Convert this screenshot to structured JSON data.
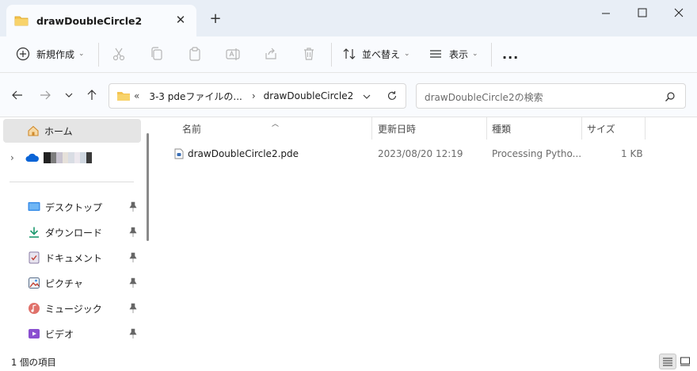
{
  "window": {
    "tab_title": "drawDoubleCircle2",
    "colors": {
      "folder": "#f4c350",
      "accent": "#0067c0",
      "onedrive": "#0a64d6"
    }
  },
  "toolbar": {
    "new_label": "新規作成",
    "sort_label": "並べ替え",
    "view_label": "表示",
    "more_label": "..."
  },
  "address": {
    "overflow": "«",
    "crumbs": [
      "3-3 pdeファイルの...",
      "drawDoubleCircle2"
    ]
  },
  "search": {
    "placeholder": "drawDoubleCircle2の検索"
  },
  "sidebar": {
    "home": "ホーム",
    "quick_access": [
      {
        "label": "デスクトップ",
        "icon": "desktop-icon"
      },
      {
        "label": "ダウンロード",
        "icon": "download-icon"
      },
      {
        "label": "ドキュメント",
        "icon": "documents-icon"
      },
      {
        "label": "ピクチャ",
        "icon": "pictures-icon"
      },
      {
        "label": "ミュージック",
        "icon": "music-icon"
      },
      {
        "label": "ビデオ",
        "icon": "videos-icon"
      }
    ]
  },
  "columns": {
    "name": "名前",
    "date": "更新日時",
    "type": "種類",
    "size": "サイズ"
  },
  "files": [
    {
      "name": "drawDoubleCircle2.pde",
      "date": "2023/08/20 12:19",
      "type": "Processing Pytho...",
      "size": "1 KB"
    }
  ],
  "status": {
    "count": "1 個の項目"
  }
}
